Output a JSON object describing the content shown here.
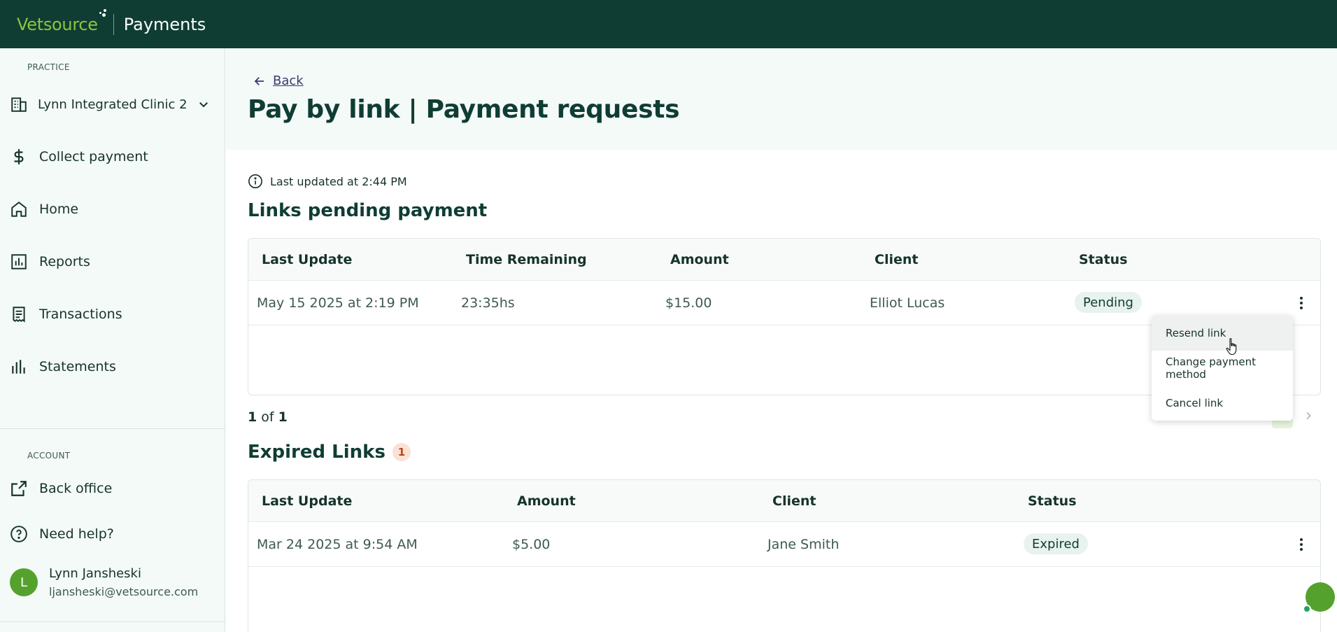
{
  "header": {
    "brand": "Vetsource",
    "app_title": "Payments"
  },
  "sidebar": {
    "practice_label": "PRACTICE",
    "practice_name": "Lynn Integrated Clinic 2",
    "nav": [
      {
        "label": "Collect payment",
        "icon": "dollar-icon"
      },
      {
        "label": "Home",
        "icon": "home-icon"
      },
      {
        "label": "Reports",
        "icon": "bar-chart-icon"
      },
      {
        "label": "Transactions",
        "icon": "receipt-icon"
      },
      {
        "label": "Statements",
        "icon": "statements-icon"
      }
    ],
    "account_label": "ACCOUNT",
    "account_items": [
      {
        "label": "Back office",
        "icon": "external-link-icon"
      },
      {
        "label": "Need help?",
        "icon": "help-icon"
      }
    ],
    "user": {
      "initial": "L",
      "name": "Lynn Jansheski",
      "email": "ljansheski@vetsource.com"
    }
  },
  "main": {
    "back_label": "Back",
    "title": "Pay by link | Payment requests",
    "last_updated": "Last updated at 2:44 PM",
    "pending": {
      "heading": "Links pending payment",
      "columns": [
        "Last Update",
        "Time Remaining",
        "Amount",
        "Client",
        "Status"
      ],
      "rows": [
        {
          "last_update": "May 15 2025 at 2:19 PM",
          "time_remaining": "23:35hs",
          "amount": "$15.00",
          "client": "Elliot Lucas",
          "status": "Pending"
        }
      ],
      "pager": {
        "current": "1",
        "of": "of",
        "total": "1"
      }
    },
    "expired": {
      "heading": "Expired Links",
      "count": "1",
      "columns": [
        "Last Update",
        "Amount",
        "Client",
        "Status"
      ],
      "rows": [
        {
          "last_update": "Mar 24 2025 at 9:54 AM",
          "amount": "$5.00",
          "client": "Jane Smith",
          "status": "Expired"
        }
      ]
    },
    "row_menu": {
      "items": [
        "Resend link",
        "Change payment method",
        "Cancel link"
      ],
      "hovered_index": 0
    }
  },
  "colors": {
    "topbar": "#0f3d33",
    "brand_green": "#8cc63f",
    "sidebar_bg": "#f4faf8",
    "avatar": "#55a12d",
    "badge_bg": "#fbe1d4"
  }
}
